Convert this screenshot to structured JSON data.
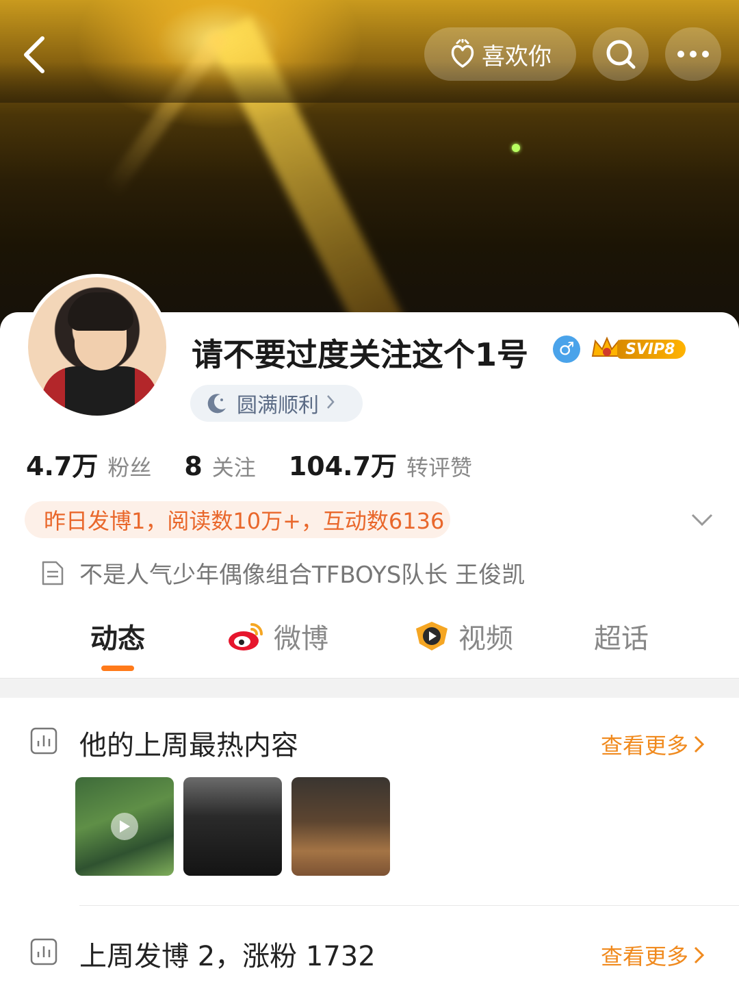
{
  "header": {
    "like_label": "喜欢你"
  },
  "profile": {
    "name": "请不要过度关注这个1号",
    "gender_symbol": "♂",
    "svip_label": "SVIP8",
    "status_label": "圆满顺利",
    "stats": [
      {
        "value": "4.7万",
        "label": "粉丝"
      },
      {
        "value": "8",
        "label": "关注"
      },
      {
        "value": "104.7万",
        "label": "转评赞"
      }
    ],
    "notice": "昨日发博1，阅读数10万+，互动数6136",
    "bio": "不是人气少年偶像组合TFBOYS队长 王俊凯"
  },
  "tabs": [
    {
      "label": "动态",
      "active": true
    },
    {
      "label": "微博",
      "icon": "weibo-icon"
    },
    {
      "label": "视频",
      "icon": "video-icon"
    },
    {
      "label": "超话"
    }
  ],
  "sections": [
    {
      "title": "他的上周最热内容",
      "more": "查看更多"
    },
    {
      "title": "上周发博 2，涨粉 1732",
      "more": "查看更多"
    }
  ],
  "colors": {
    "accent": "#ff7a1a",
    "link_orange": "#f08a1e",
    "notice_text": "#e9672b",
    "notice_bg": "#fdf0e8",
    "verified_blue": "#4aa3ea"
  }
}
